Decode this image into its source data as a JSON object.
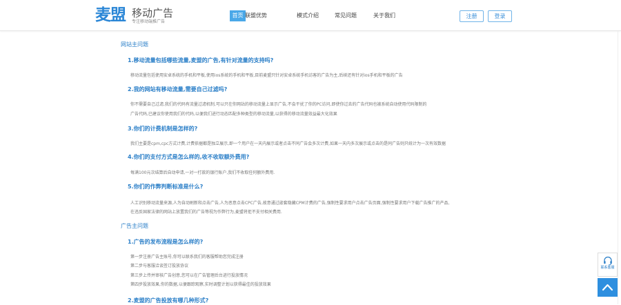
{
  "header": {
    "logo": "麦盟",
    "brand": "移动广告",
    "tagline": "专注移动端推广告",
    "nav": [
      "首页",
      "联盟优势",
      "模式介绍",
      "常见问题",
      "关于我们"
    ],
    "register": "注册",
    "login": "登录"
  },
  "faq": [
    {
      "section": "网站主问题",
      "items": [
        {
          "q": "1.移动流量包括哪些流量,麦盟的广告,有针对流量的支持吗?",
          "a": [
            "移动流量包括使用安卓系统的手机和平板,使用ios系统的手机和平板,目前麦盟只针对安卓系统手机访客的广告为主,后续还有针对ios手机和平板的广告"
          ]
        },
        {
          "q": "2.我的网站有移动流量,需要自己过滤吗?",
          "a": [
            "你不需要自己过滤,我们的代码有流量过滤机制,可以只在你网站的移动流量上显示广告,不会干扰了你的PC访问,即使你过去的广告代码也被系统自动使用代码限制的",
            "广告代码,已建议你使用我们的代码,以便我们进行动态匹配多种类型的移动流量,以获得的移动流量效益最大化效果"
          ]
        },
        {
          "q": "3.你们的计费机制是怎样的?",
          "a": [
            "我们主要是cpm,cpc方式计费,计费依据都是独立展示,即一个用户在一天内展示或者点击不同广告会多次计费,如果一天内多次展示或点击的是同广告则只统计为一次有效数据"
          ]
        },
        {
          "q": "4.你们的支付方式是怎么样的,收不收取额外费用?",
          "a": [
            "每满100元次结算后自动申请,一对一打款的银行账户,我们不收取任何额外费用."
          ]
        },
        {
          "q": "5.你们的作弊判断标准是什么?",
          "a": [
            "人工识别移动流量来源,人为自动刷新和点击广告,人为恶意点击CPC广告,故意通过嵌套隐藏CPM计费的广告,强制性要求用户点击广告页面,强制性要求用户下载广告推广的产品,",
            "在违反国家法律的网站上放置我们的广告等视为作弊行为,麦盟将拒不支付相关费用."
          ]
        }
      ]
    },
    {
      "section": "广告主问题",
      "items": [
        {
          "q": "1.广告的发布流程是怎么样的?",
          "a": [
            "第一步注册广告主账号,你可以联系我们的客服帮助您完成注册",
            "第二步与客服洽谈签订投放协议",
            "第三步上传并审核广告创意,您可以在广告管理后台进行投放情况",
            "第四步投放效果,你的数据,以便跟踪观察,实时调整计划以获得最佳的投放效果"
          ]
        },
        {
          "q": "2.麦盟的广告投放有哪几种形式?",
          "a": []
        }
      ]
    }
  ],
  "widgets": {
    "support_label": "联系客服",
    "support_icon": "headset-icon",
    "to_top_icon": "arrow-up-icon"
  },
  "colors": {
    "accent": "#2b7fc8",
    "nav_active": "#4aa8e8",
    "logo": "#2a86d6",
    "to_top": "#2e8fdf"
  }
}
